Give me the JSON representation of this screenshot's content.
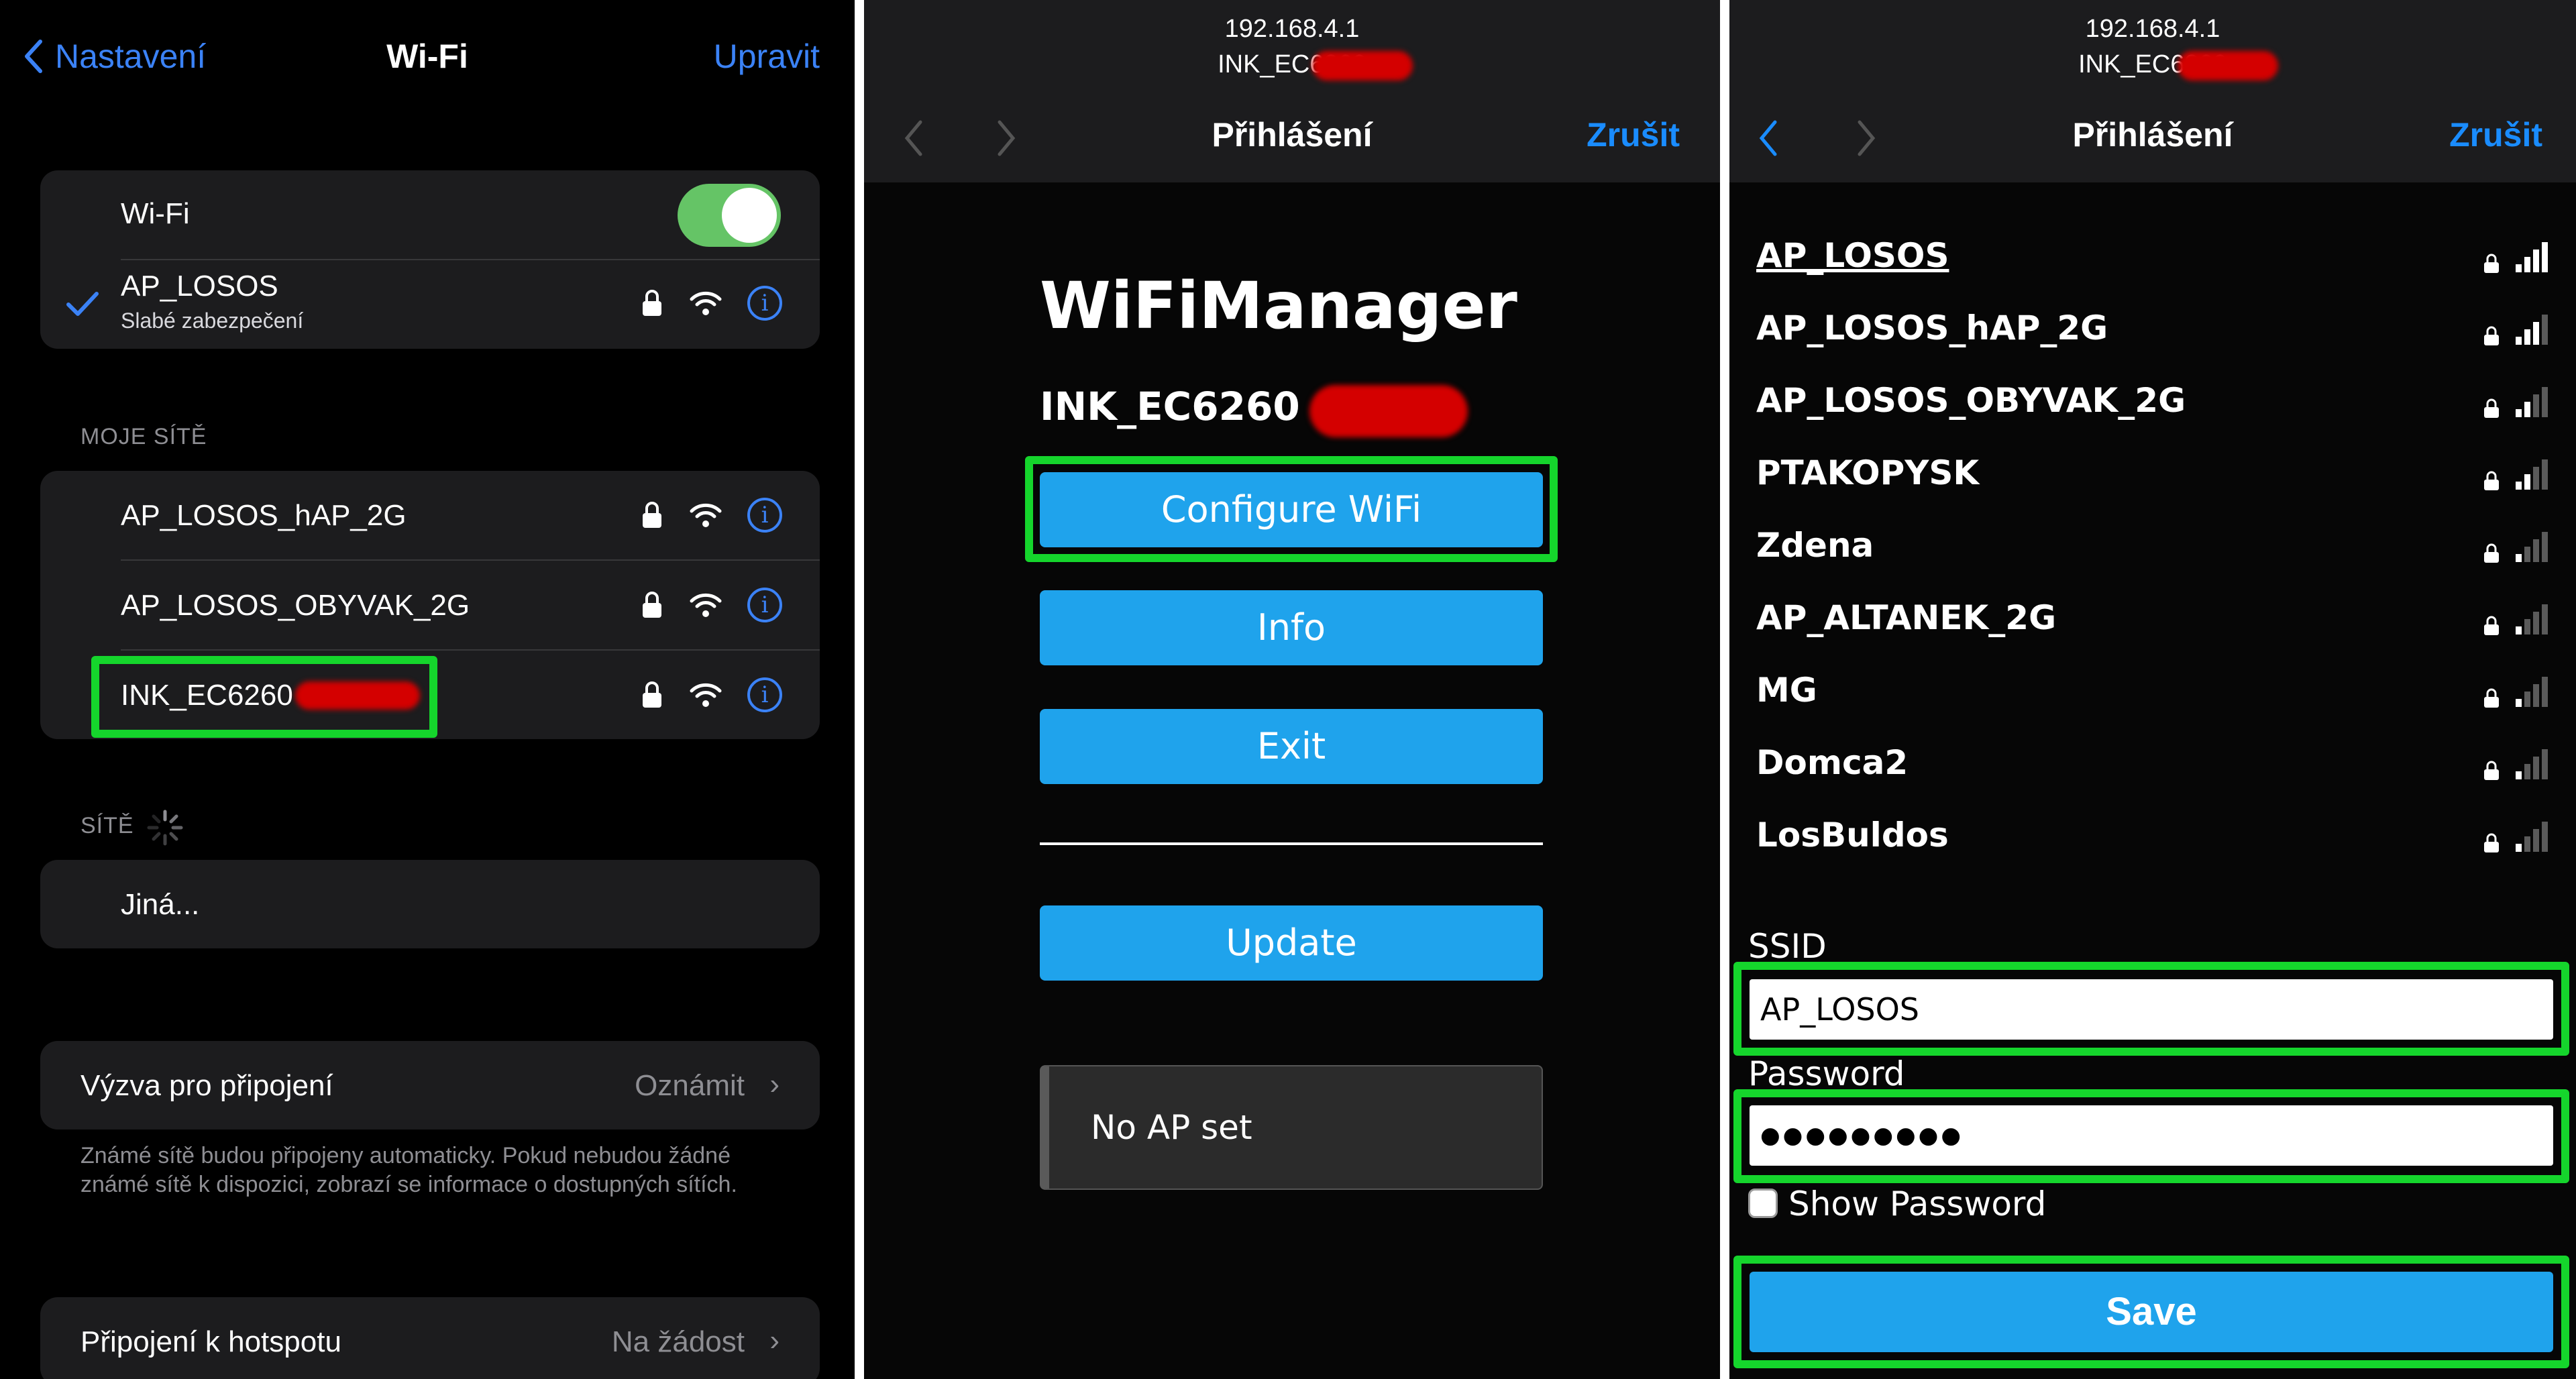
{
  "settings": {
    "back_label": "Nastavení",
    "title": "Wi-Fi",
    "edit_label": "Upravit",
    "wifi_label": "Wi-Fi",
    "wifi_on": true,
    "connected": {
      "name": "AP_LOSOS",
      "sub": "Slabé zabezpečení"
    },
    "my_networks_header": "MOJE SÍTĚ",
    "my_networks": [
      {
        "name": "AP_LOSOS_hAP_2G"
      },
      {
        "name": "AP_LOSOS_OBYVAK_2G"
      },
      {
        "name": "INK_EC6260"
      }
    ],
    "networks_header": "SÍTĚ",
    "other_label": "Jiná...",
    "ask_join": {
      "label": "Výzva pro připojení",
      "value": "Oznámit"
    },
    "ask_join_note": "Známé sítě budou připojeny automaticky. Pokud nebudou žádné známé sítě k dispozici, zobrazí se informace o dostupných sítích.",
    "hotspot": {
      "label": "Připojení k hotspotu",
      "value": "Na žádost"
    },
    "accent": "#3b82f6",
    "highlight": "#15d52c"
  },
  "portal_menu": {
    "ip": "192.168.4.1",
    "ssid": "INK_EC6260",
    "title": "Přihlášení",
    "cancel": "Zrušit",
    "heading": "WiFiManager",
    "device_ssid": "INK_EC6260",
    "buttons": {
      "configure": "Configure WiFi",
      "info": "Info",
      "exit": "Exit",
      "update": "Update"
    },
    "status_msg": "No AP set",
    "button_color": "#1fa3ec"
  },
  "portal_config": {
    "ip": "192.168.4.1",
    "ssid": "INK_EC6260",
    "title": "Přihlášení",
    "cancel": "Zrušit",
    "networks": [
      {
        "name": "AP_LOSOS",
        "bars": 4
      },
      {
        "name": "AP_LOSOS_hAP_2G",
        "bars": 3
      },
      {
        "name": "AP_LOSOS_OBYVAK_2G",
        "bars": 2
      },
      {
        "name": "PTAKOPYSK",
        "bars": 2
      },
      {
        "name": "Zdena",
        "bars": 1
      },
      {
        "name": "AP_ALTANEK_2G",
        "bars": 1
      },
      {
        "name": "MG",
        "bars": 1
      },
      {
        "name": "Domca2",
        "bars": 1
      },
      {
        "name": "LosBuldos",
        "bars": 1
      }
    ],
    "ssid_label": "SSID",
    "ssid_value": "AP_LOSOS",
    "password_label": "Password",
    "password_value": "●●●●●●●●●",
    "show_password": "Show Password",
    "save": "Save"
  }
}
